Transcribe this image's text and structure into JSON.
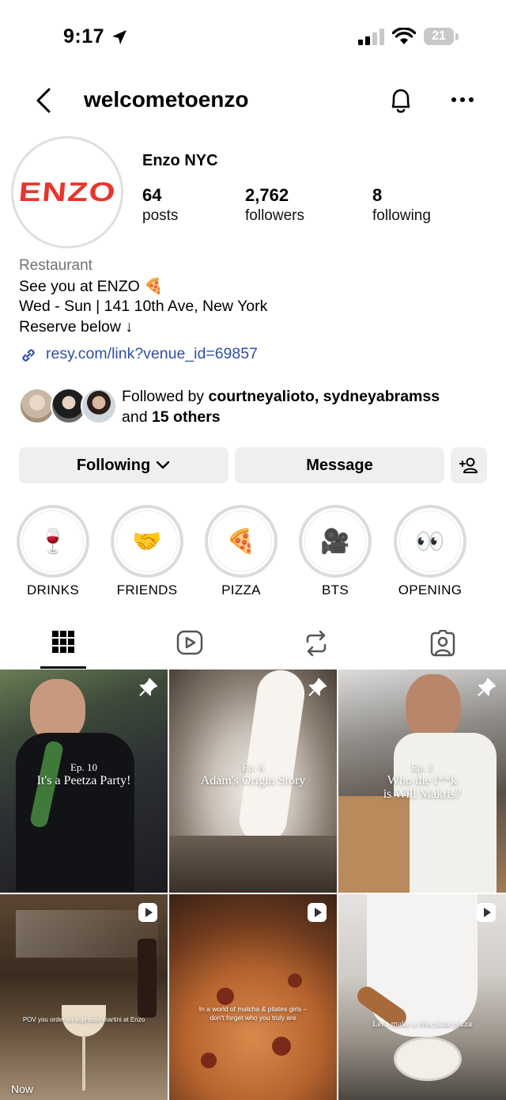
{
  "status_bar": {
    "time": "9:17",
    "battery": "21"
  },
  "header": {
    "username": "welcometoenzo"
  },
  "profile": {
    "logo_text": "ENZO",
    "name": "Enzo NYC",
    "stats": [
      {
        "value": "64",
        "label": "posts"
      },
      {
        "value": "2,762",
        "label": "followers"
      },
      {
        "value": "8",
        "label": "following"
      }
    ],
    "category": "Restaurant",
    "bio": [
      "See you at ENZO 🍕",
      "Wed - Sun | 141 10th Ave, New York",
      "Reserve below ↓"
    ],
    "link": "resy.com/link?venue_id=69857",
    "followed_by": {
      "prefix": "Followed by ",
      "names": "courtneyalioto, sydneyabramss",
      "and": "and ",
      "others": "15 others"
    }
  },
  "buttons": {
    "following": "Following",
    "message": "Message"
  },
  "highlights": [
    {
      "label": "DRINKS",
      "emoji": "🍷"
    },
    {
      "label": "FRIENDS",
      "emoji": "🤝"
    },
    {
      "label": "PIZZA",
      "emoji": "🍕"
    },
    {
      "label": "BTS",
      "emoji": "🎥"
    },
    {
      "label": "OPENING",
      "emoji": "👀"
    }
  ],
  "posts": [
    {
      "ep": "Ep. 10",
      "title": "It's a Peetza Party!"
    },
    {
      "ep": "Ep. 6",
      "title": "Adam's Origin Story"
    },
    {
      "ep": "Ep. 1",
      "title": "Who the f**k",
      "title2": "is Will Makris?"
    },
    {
      "caption": "POV you order an espresso martini at Enzo",
      "footer": "Now"
    },
    {
      "caption": "In a world of matcha & pilates girls – don't forget who you truly are"
    },
    {
      "caption": "Let's make a chocolate pizza"
    }
  ],
  "colors": {
    "accent_link": "#2f4fa6",
    "logo_red": "#e8352c",
    "button_bg": "#efefef"
  }
}
